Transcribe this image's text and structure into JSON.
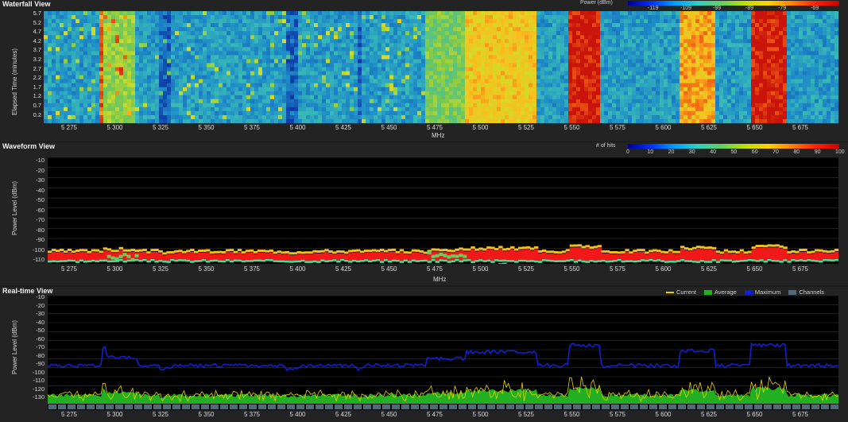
{
  "waterfall": {
    "title": "Waterfall View",
    "y_label": "Elapsed Time (minutes)",
    "x_label": "MHz",
    "power_scale_label": "Power (dBm)",
    "power_scale_ticks": [
      "-119",
      "-109",
      "-99",
      "-89",
      "-79",
      "-69"
    ],
    "y_ticks": [
      "5.7",
      "5.2",
      "4.7",
      "4.2",
      "3.7",
      "3.2",
      "2.7",
      "2.2",
      "1.7",
      "1.2",
      "0.7",
      "0.2"
    ]
  },
  "waveform": {
    "title": "Waveform View",
    "y_label": "Power Level (dBm)",
    "x_label": "MHz",
    "hits_scale_label": "# of hits",
    "hits_scale_ticks": [
      "0",
      "10",
      "20",
      "30",
      "40",
      "50",
      "60",
      "70",
      "80",
      "90",
      "100"
    ],
    "y_ticks": [
      "-10",
      "-20",
      "-30",
      "-40",
      "-50",
      "-60",
      "-70",
      "-80",
      "-90",
      "-100",
      "-110"
    ]
  },
  "realtime": {
    "title": "Real-time View",
    "y_label": "Power Level (dBm)",
    "legend": {
      "current": "Current",
      "average": "Average",
      "maximum": "Maximum",
      "channels": "Channels"
    },
    "y_ticks": [
      "-10",
      "-20",
      "-30",
      "-40",
      "-50",
      "-60",
      "-70",
      "-80",
      "-90",
      "-100",
      "-110",
      "-120",
      "-130"
    ]
  },
  "x_ticks": [
    "5 275",
    "5 300",
    "5 325",
    "5 350",
    "5 375",
    "5 400",
    "5 425",
    "5 450",
    "5 475",
    "5 500",
    "5 525",
    "5 550",
    "5 575",
    "5 600",
    "5 625",
    "5 650",
    "5 675"
  ],
  "colors": {
    "current": "#e8d000",
    "average": "#22b022",
    "maximum": "#1020d0",
    "channels": "#506a78"
  }
}
